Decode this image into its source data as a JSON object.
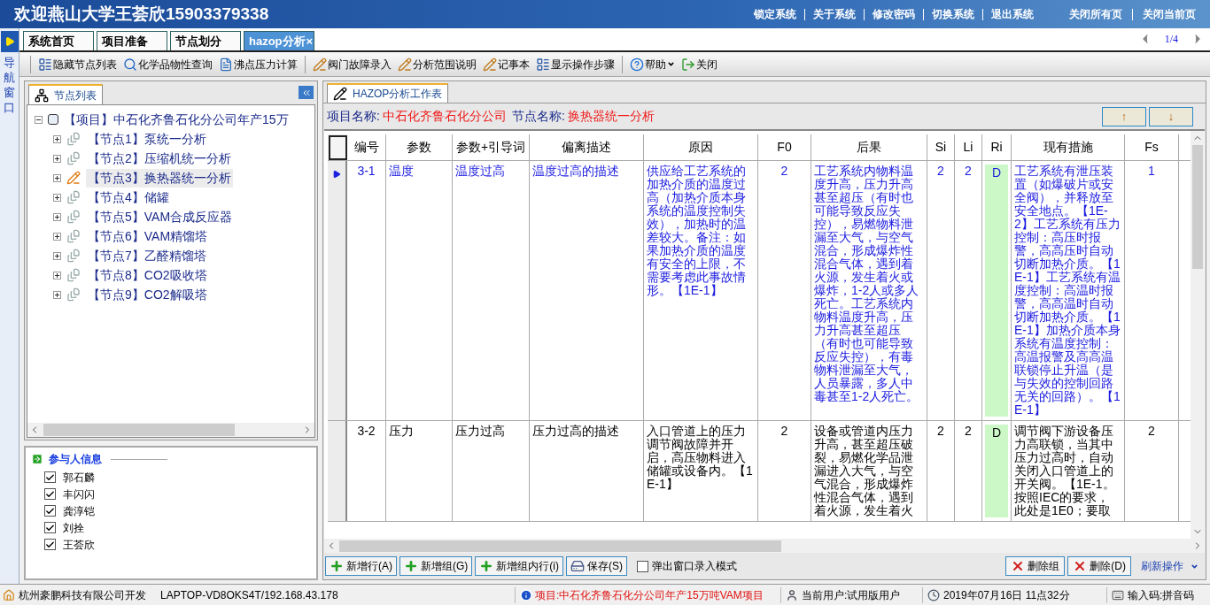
{
  "header": {
    "title": "欢迎燕山大学王荟欣15903379338",
    "links": [
      "锁定系统",
      "关于系统",
      "修改密码",
      "切换系统",
      "退出系统"
    ],
    "page_links": [
      "关闭所有页",
      "关闭当前页"
    ]
  },
  "nav_strip": {
    "label": "导航窗口"
  },
  "tabs": [
    {
      "label": "系统首页",
      "selected": false,
      "closable": false
    },
    {
      "label": "项目准备",
      "selected": false,
      "closable": false
    },
    {
      "label": "节点划分",
      "selected": false,
      "closable": false
    },
    {
      "label": "hazop分析",
      "selected": true,
      "closable": true
    }
  ],
  "close_tab_mark": "×",
  "pager": "1/4",
  "toolbar": [
    {
      "kind": "list",
      "label": "隐藏节点列表"
    },
    {
      "kind": "search",
      "label": "化学品物性查询"
    },
    {
      "kind": "doc",
      "label": "沸点压力计算"
    },
    {
      "kind": "edit",
      "label": "阀门故障录入"
    },
    {
      "kind": "edit",
      "label": "分析范围说明"
    },
    {
      "kind": "edit",
      "label": "记事本"
    },
    {
      "kind": "list",
      "label": "显示操作步骤"
    },
    {
      "kind": "help",
      "label": "帮助",
      "dropdown": true
    },
    {
      "kind": "exit",
      "label": "关闭"
    }
  ],
  "left_panel": {
    "tab": "节点列表",
    "tree": {
      "label": "【项目】中石化齐鲁石化分公司年产15万",
      "expanded": true,
      "children": [
        {
          "label": "【节点1】泵统一分析",
          "selected": false,
          "expanded": false
        },
        {
          "label": "【节点2】压缩机统一分析",
          "selected": false,
          "expanded": false
        },
        {
          "label": "【节点3】换热器统一分析",
          "selected": true,
          "expanded": false
        },
        {
          "label": "【节点4】储罐",
          "selected": false,
          "expanded": false
        },
        {
          "label": "【节点5】VAM合成反应器",
          "selected": false,
          "expanded": false
        },
        {
          "label": "【节点6】VAM精馏塔",
          "selected": false,
          "expanded": false
        },
        {
          "label": "【节点7】乙醛精馏塔",
          "selected": false,
          "expanded": false
        },
        {
          "label": "【节点8】CO2吸收塔",
          "selected": false,
          "expanded": false
        },
        {
          "label": "【节点9】CO2解吸塔",
          "selected": false,
          "expanded": false
        }
      ]
    }
  },
  "participants": {
    "title": "参与人信息",
    "items": [
      {
        "name": "郭石麟",
        "checked": true
      },
      {
        "name": "丰闪闪",
        "checked": true
      },
      {
        "name": "龚淳铠",
        "checked": true
      },
      {
        "name": "刘拴",
        "checked": true
      },
      {
        "name": "王荟欣",
        "checked": true
      }
    ]
  },
  "work_tab": "HAZOP分析工作表",
  "info": {
    "project_label": "项目名称:",
    "project": "中石化齐鲁石化分公司",
    "node_label": "节点名称:",
    "node": "换热器统一分析"
  },
  "sort_buttons": [
    "↑",
    "↓"
  ],
  "table": {
    "columns": [
      "编号",
      "参数",
      "参数+引导词",
      "偏离描述",
      "原因",
      "F0",
      "后果",
      "Si",
      "Li",
      "Ri",
      "现有措施",
      "Fs"
    ],
    "rows": [
      {
        "selected": true,
        "cells": [
          "3-1",
          "温度",
          "温度过高",
          "温度过高的描述",
          "供应给工艺系统的加热介质的温度过高（加热介质本身系统的温度控制失效），加热时的温差较大。备注：如果加热介质的温度有安全的上限，不需要考虑此事故情形。【1E-1】",
          "2",
          "工艺系统内物料温度升高，压力升高甚至超压（有时也可能导致反应失控），易燃物料泄漏至大气，与空气混合，形成爆炸性混合气体，遇到着火源，发生着火或爆炸，1-2人或多人死亡。工艺系统内物料温度升高，压力升高甚至超压（有时也可能导致反应失控），有毒物料泄漏至大气，人员暴露，多人中毒甚至1-2人死亡。",
          "2",
          "2",
          "D",
          "工艺系统有泄压装置（如爆破片或安全阀），并释放至安全地点。【1E-2】工艺系统有压力控制：高压时报警，高高压时自动切断加热介质。【1E-1】工艺系统有温度控制：高温时报警，高高温时自动切断加热介质。【1E-1】加热介质本身系统有温度控制：高温报警及高高温联锁停止升温（是与失效的控制回路无关的回路）。【1E-1】",
          "1"
        ]
      },
      {
        "selected": false,
        "cells": [
          "3-2",
          "压力",
          "压力过高",
          "压力过高的描述",
          "入口管道上的压力调节阀故障并开启，高压物料进入储罐或设备内。【1E-1】",
          "2",
          "设备或管道内压力升高，甚至超压破裂，易燃化学品泄漏进入大气，与空气混合，形成爆炸性混合气体，遇到着火源，发生着火",
          "2",
          "2",
          "D",
          "调节阀下游设备压力高联锁，当其中压力过高时，自动关闭入口管道上的开关阀。【1E-1。按照IEC的要求，此处是1E0；要取",
          "2"
        ]
      }
    ]
  },
  "bottom_buttons": [
    {
      "kind": "add",
      "label": "新增行(A)"
    },
    {
      "kind": "add",
      "label": "新增组(G)"
    },
    {
      "kind": "add",
      "label": "新增组内行(i)"
    },
    {
      "kind": "save",
      "label": "保存(S)"
    }
  ],
  "popup_mode": {
    "label": "弹出窗口录入模式",
    "checked": false
  },
  "delete_buttons": [
    {
      "kind": "delete",
      "label": "删除组"
    },
    {
      "kind": "delete",
      "label": "删除(D)"
    }
  ],
  "refresh": "刷新操作",
  "status_bar": {
    "company": "杭州豪鹏科技有限公司开发",
    "host": "LAPTOP-VD8OKS4T/192.168.43.178",
    "project": "项目:中石化齐鲁石化分公司年产15万吨VAM项目",
    "user": "当前用户:试用版用户",
    "datetime": "2019年07月16日 11点32分",
    "ime": "输入码:拼音码"
  }
}
